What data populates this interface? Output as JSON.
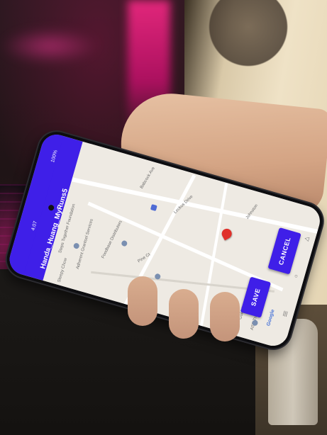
{
  "status_bar": {
    "time": "4:07",
    "battery": "100%"
  },
  "app_bar": {
    "title": "Handa_Huang_MyRuns5"
  },
  "map": {
    "labels": [
      "Steps Together Foundation",
      "Foodbase Distributors",
      "Johnston",
      "Adherent Grantsel Services",
      "Leckus Drive",
      "Pine Ct",
      "Babcock Ave",
      "Gold Ct",
      "ASE Trading",
      "Sleepy Chow"
    ],
    "marker_icon": "red-location-pin-icon",
    "attribution": "Google"
  },
  "buttons": {
    "save": "SAVE",
    "cancel": "CANCEL"
  },
  "colors": {
    "accent": "#3f1fe8",
    "marker": "#e0302a"
  }
}
